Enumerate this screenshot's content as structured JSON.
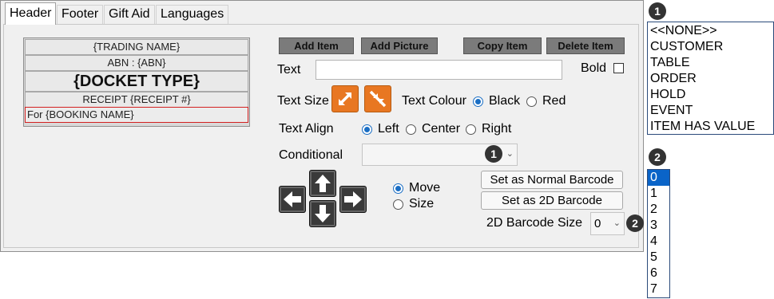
{
  "tabs": [
    "Header",
    "Footer",
    "Gift Aid",
    "Languages"
  ],
  "docket_lines": [
    "{TRADING NAME}",
    "ABN : {ABN}",
    "{DOCKET TYPE}",
    "RECEIPT {RECEIPT #}",
    "For {BOOKING NAME}"
  ],
  "buttons": {
    "add_item": "Add Item",
    "add_picture": "Add Picture",
    "copy_item": "Copy Item",
    "delete_item": "Delete Item",
    "set_normal_barcode": "Set as Normal Barcode",
    "set_2d_barcode": "Set as 2D Barcode"
  },
  "labels": {
    "text": "Text",
    "bold": "Bold",
    "text_size": "Text Size",
    "text_colour": "Text Colour",
    "text_align": "Text Align",
    "conditional": "Conditional",
    "barcode_size": "2D Barcode Size"
  },
  "text_field": {
    "value": ""
  },
  "bold_checked": false,
  "colour_options": [
    "Black",
    "Red"
  ],
  "colour_selected": "Black",
  "align_options": [
    "Left",
    "Center",
    "Right"
  ],
  "align_selected": "Left",
  "move_mode_options": [
    "Move",
    "Size"
  ],
  "move_mode_selected": "Move",
  "conditional_value": "",
  "barcode_size_value": "0",
  "badges": {
    "one": "1",
    "two": "2"
  },
  "conditional_options": [
    "<<NONE>>",
    "CUSTOMER",
    "TABLE",
    "ORDER",
    "HOLD",
    "EVENT",
    "ITEM HAS VALUE"
  ],
  "barcode_size_options": [
    "0",
    "1",
    "2",
    "3",
    "4",
    "5",
    "6",
    "7"
  ],
  "barcode_size_highlighted": "0",
  "colors": {
    "accent": "#1a6ec4",
    "orange": "#e87722",
    "highlight": "#0a64c8"
  },
  "icons": {
    "grow": "expand-arrows-icon",
    "shrink": "shrink-arrows-icon"
  }
}
